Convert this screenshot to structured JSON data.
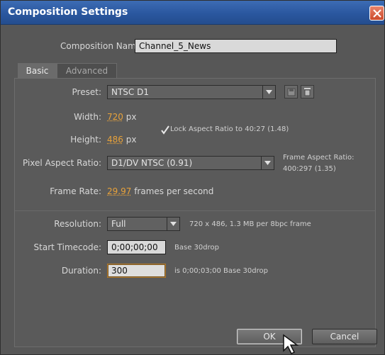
{
  "window": {
    "title": "Composition Settings"
  },
  "composition_name": {
    "label": "Composition Name:",
    "value": "Channel_5_News"
  },
  "tabs": [
    {
      "label": "Basic"
    },
    {
      "label": "Advanced"
    }
  ],
  "preset": {
    "label": "Preset:",
    "value": "NTSC D1"
  },
  "width": {
    "label": "Width:",
    "value": "720",
    "unit": "px"
  },
  "height": {
    "label": "Height:",
    "value": "486",
    "unit": "px"
  },
  "lock_aspect": {
    "label": "Lock Aspect Ratio to 40:27 (1.48)",
    "checked": true
  },
  "pixel_aspect": {
    "label": "Pixel Aspect Ratio:",
    "value": "D1/DV NTSC (0.91)"
  },
  "frame_aspect": {
    "label": "Frame Aspect Ratio:",
    "value": "400:297 (1.35)"
  },
  "frame_rate": {
    "label": "Frame Rate:",
    "value": "29.97",
    "unit": "frames per second"
  },
  "resolution": {
    "label": "Resolution:",
    "value": "Full",
    "info": "720 x 486, 1.3 MB per 8bpc frame"
  },
  "start_timecode": {
    "label": "Start Timecode:",
    "value": "0;00;00;00",
    "info": "Base 30drop"
  },
  "duration": {
    "label": "Duration:",
    "value": "300",
    "info": "is 0;00;03;00  Base 30drop"
  },
  "buttons": {
    "ok": "OK",
    "cancel": "Cancel"
  },
  "icons": {
    "close": "close-icon",
    "save": "save-preset-icon",
    "delete": "trash-icon",
    "cursor": "mouse-pointer-icon"
  },
  "colors": {
    "titlebar": "#2a579f",
    "accent_value": "#e8a23a",
    "background": "#575757"
  }
}
